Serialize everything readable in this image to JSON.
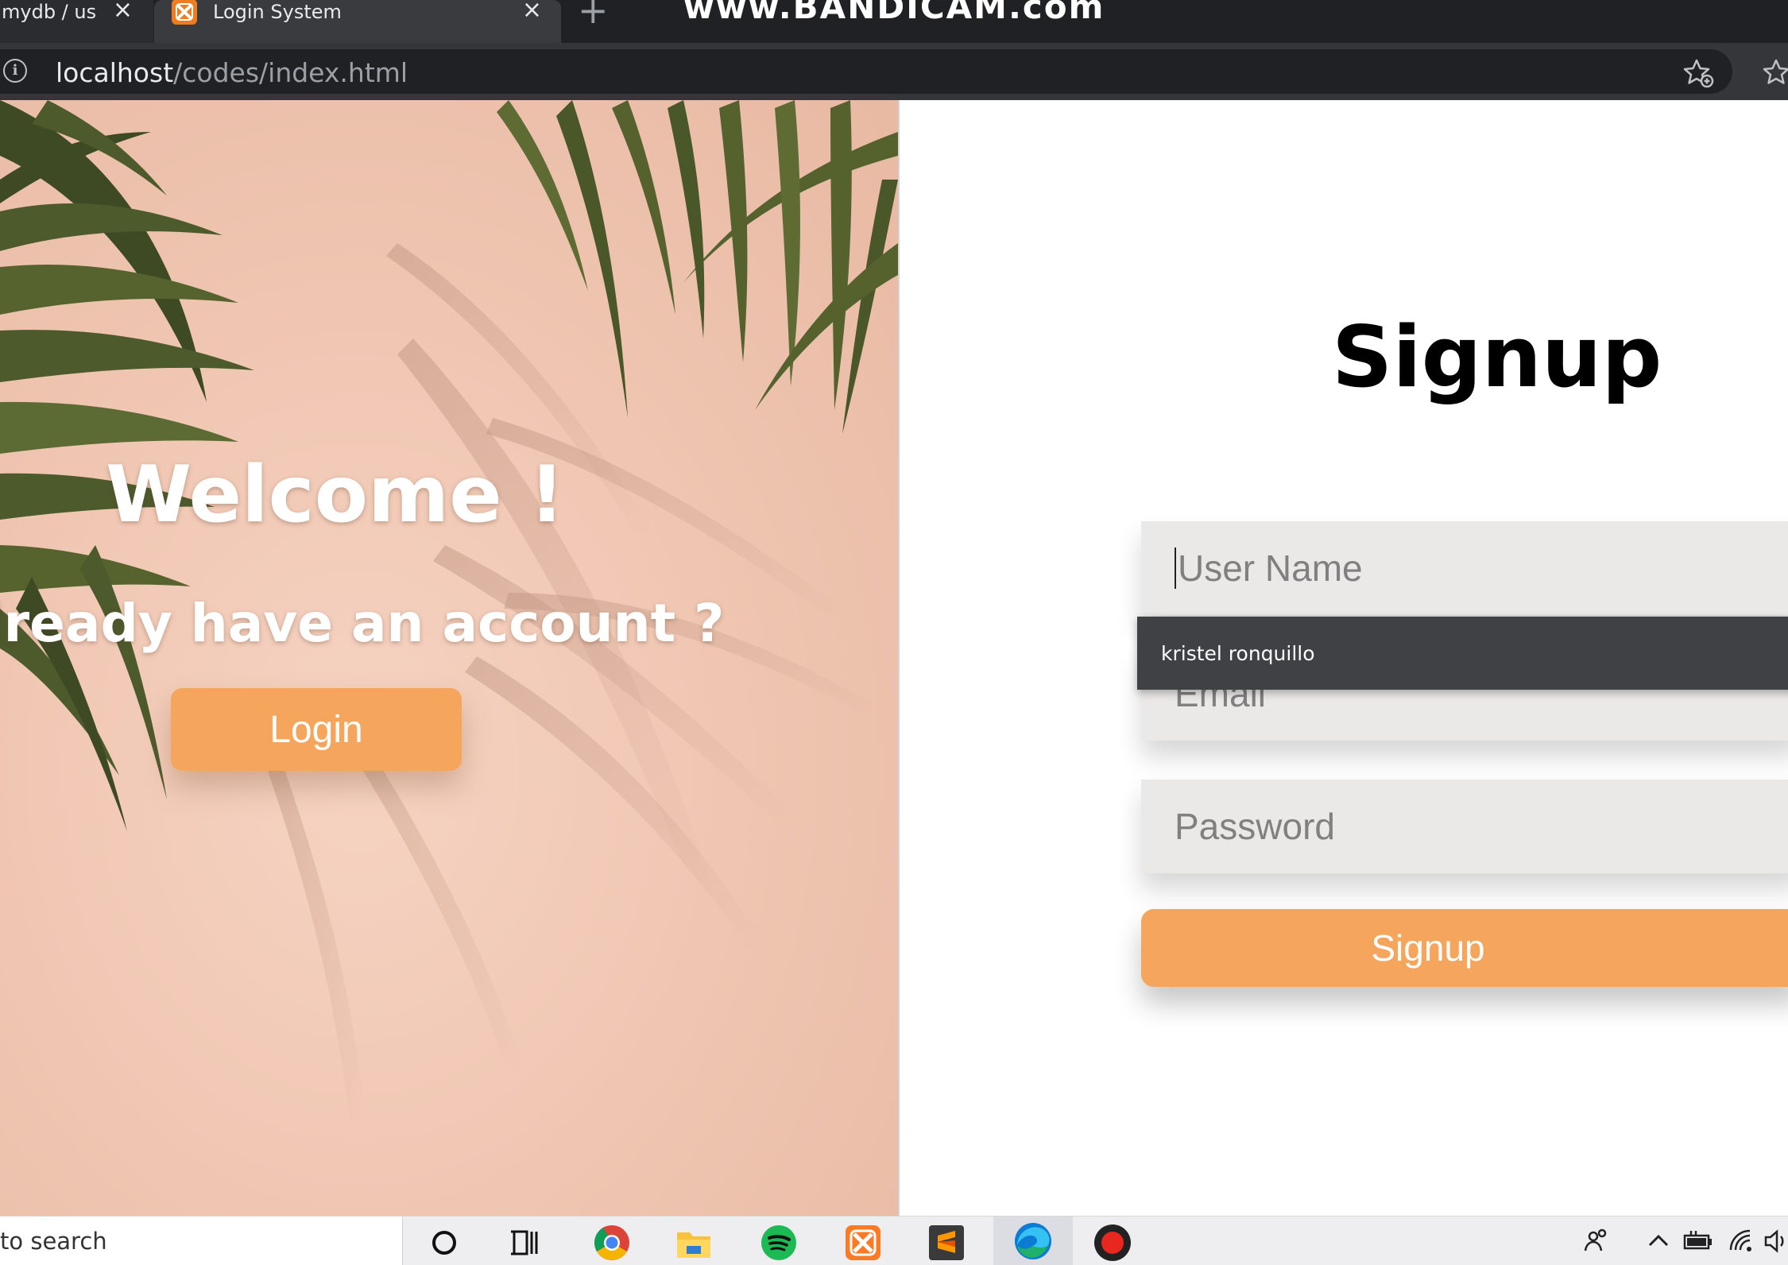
{
  "browser": {
    "tabs": [
      {
        "label": "mydb / us"
      },
      {
        "label": "Login System"
      }
    ],
    "watermark": "www.BANDICAM.com",
    "address": {
      "host": "localhost",
      "path": "/codes/index.html"
    }
  },
  "hero": {
    "welcome": "Welcome !",
    "prompt": "lready have an account ?",
    "login_label": "Login"
  },
  "signup": {
    "title": "Signup",
    "username_placeholder": "User Name",
    "email_placeholder": "Email",
    "password_placeholder": "Password",
    "autofill_suggestion": "kristel ronquillo",
    "submit_label": "Signup"
  },
  "taskbar": {
    "search_text": "to search",
    "apps": [
      "cortana-icon",
      "task-view-icon",
      "chrome-icon",
      "file-explorer-icon",
      "spotify-icon",
      "xampp-icon",
      "sublime-text-icon",
      "edge-icon",
      "bandicam-record-icon"
    ],
    "tray": [
      "people-icon",
      "chevron-up-icon",
      "battery-icon",
      "wifi-icon",
      "volume-icon"
    ]
  },
  "colors": {
    "accent": "#f5a55c",
    "hero_background": "#f0c7b3",
    "input_background": "#ebe8e8",
    "autofill_background": "#404144",
    "browser_dark": "#202124"
  }
}
